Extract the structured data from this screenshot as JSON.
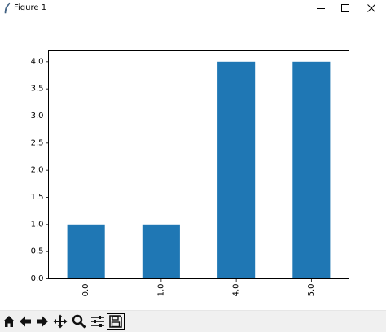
{
  "window": {
    "title": "Figure 1",
    "controls": [
      "minimize",
      "maximize",
      "close"
    ]
  },
  "toolbar": {
    "buttons": [
      "home-icon",
      "back-icon",
      "forward-icon",
      "pan-icon",
      "zoom-icon",
      "configure-subplots-icon",
      "save-icon"
    ]
  },
  "chart_data": {
    "type": "bar",
    "categories": [
      "0.0",
      "1.0",
      "4.0",
      "5.0"
    ],
    "values": [
      1,
      1,
      4,
      4
    ],
    "title": "",
    "xlabel": "",
    "ylabel": "",
    "ylim": [
      0,
      4.2
    ],
    "yticks": [
      "0.0",
      "0.5",
      "1.0",
      "1.5",
      "2.0",
      "2.5",
      "3.0",
      "3.5",
      "4.0"
    ],
    "x_tick_rotation": "vertical",
    "bar_color": "#1f77b4",
    "grid": false,
    "legend": "none"
  }
}
